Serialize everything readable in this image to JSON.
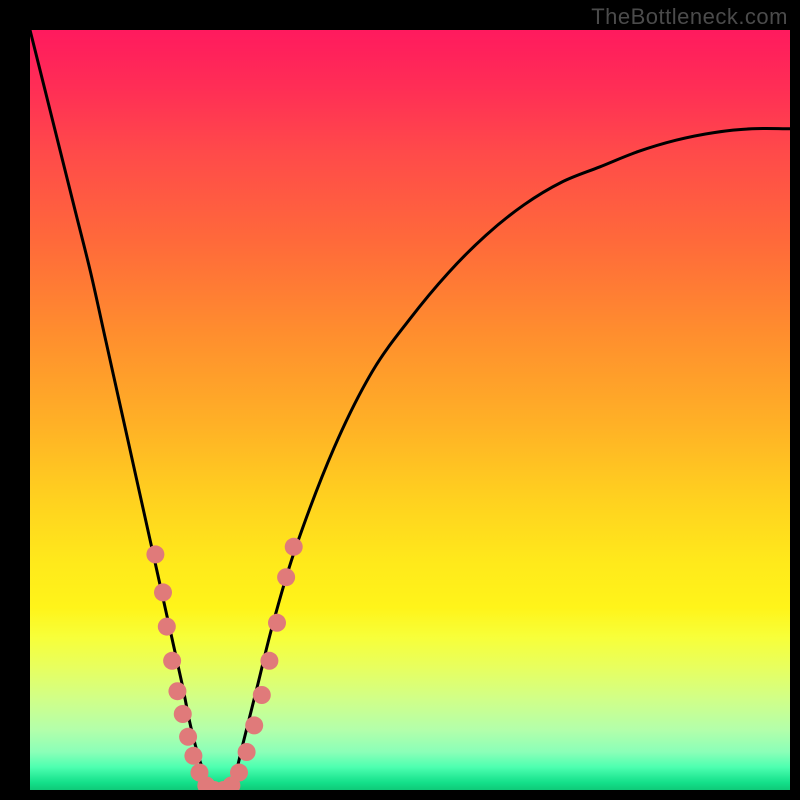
{
  "watermark": "TheBottleneck.com",
  "chart_data": {
    "type": "line",
    "title": "",
    "xlabel": "",
    "ylabel": "",
    "xlim": [
      0,
      100
    ],
    "ylim": [
      0,
      100
    ],
    "grid": false,
    "background_gradient": {
      "orientation": "vertical",
      "stops": [
        {
          "pos": 0.0,
          "color": "#ff1a5e"
        },
        {
          "pos": 0.3,
          "color": "#ff7a35"
        },
        {
          "pos": 0.6,
          "color": "#ffd21f"
        },
        {
          "pos": 0.8,
          "color": "#f7ff3a"
        },
        {
          "pos": 0.95,
          "color": "#8bffb8"
        },
        {
          "pos": 1.0,
          "color": "#0fc978"
        }
      ]
    },
    "series": [
      {
        "name": "bottleneck-curve",
        "color": "#000000",
        "x": [
          0,
          2,
          4,
          6,
          8,
          10,
          12,
          14,
          16,
          18,
          20,
          21,
          22,
          23,
          24,
          25,
          26,
          27,
          28,
          30,
          32,
          35,
          40,
          45,
          50,
          55,
          60,
          65,
          70,
          75,
          80,
          85,
          90,
          95,
          100
        ],
        "values": [
          100,
          92,
          84,
          76,
          68,
          59,
          50,
          41,
          32,
          23,
          14,
          9,
          5,
          2,
          0,
          0,
          0,
          2,
          6,
          14,
          22,
          32,
          45,
          55,
          62,
          68,
          73,
          77,
          80,
          82,
          84,
          85.5,
          86.5,
          87,
          87
        ]
      }
    ],
    "markers": {
      "name": "highlight-dots",
      "color": "#e07a7a",
      "radius_px": 9,
      "points": [
        {
          "x": 16.5,
          "y": 31
        },
        {
          "x": 17.5,
          "y": 26
        },
        {
          "x": 18.0,
          "y": 21.5
        },
        {
          "x": 18.7,
          "y": 17
        },
        {
          "x": 19.4,
          "y": 13
        },
        {
          "x": 20.1,
          "y": 10
        },
        {
          "x": 20.8,
          "y": 7
        },
        {
          "x": 21.5,
          "y": 4.5
        },
        {
          "x": 22.3,
          "y": 2.3
        },
        {
          "x": 23.2,
          "y": 0.6
        },
        {
          "x": 24.2,
          "y": 0
        },
        {
          "x": 25.5,
          "y": 0
        },
        {
          "x": 26.5,
          "y": 0.6
        },
        {
          "x": 27.5,
          "y": 2.3
        },
        {
          "x": 28.5,
          "y": 5
        },
        {
          "x": 29.5,
          "y": 8.5
        },
        {
          "x": 30.5,
          "y": 12.5
        },
        {
          "x": 31.5,
          "y": 17
        },
        {
          "x": 32.5,
          "y": 22
        },
        {
          "x": 33.7,
          "y": 28
        },
        {
          "x": 34.7,
          "y": 32
        }
      ]
    }
  }
}
